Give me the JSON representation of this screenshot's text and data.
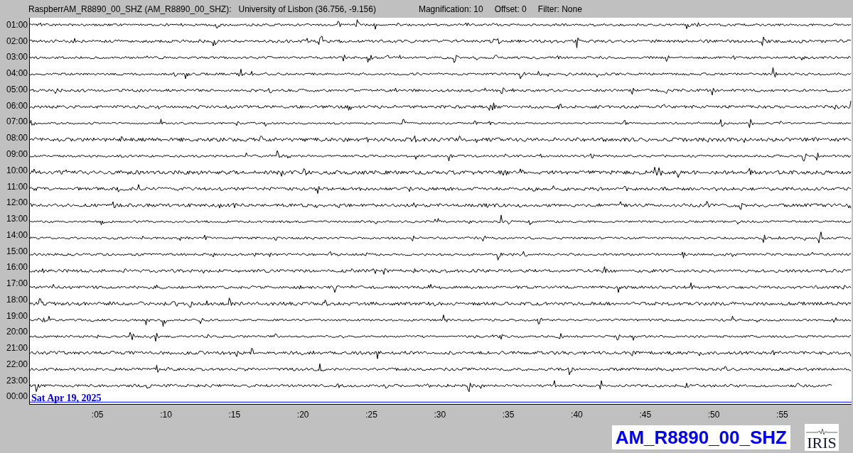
{
  "header": {
    "station": "RaspberrAM_R8890_00_SHZ (AM_R8890_00_SHZ):",
    "location": "University of Lisbon (36.756, -9.156)",
    "magnification": "Magnification: 10",
    "offset": "Offset: 0",
    "filter": "Filter: None"
  },
  "rows": [
    {
      "label": "01:00",
      "kind": "trace"
    },
    {
      "label": "02:00",
      "kind": "trace"
    },
    {
      "label": "03:00",
      "kind": "trace"
    },
    {
      "label": "04:00",
      "kind": "trace"
    },
    {
      "label": "05:00",
      "kind": "trace"
    },
    {
      "label": "06:00",
      "kind": "trace"
    },
    {
      "label": "07:00",
      "kind": "trace"
    },
    {
      "label": "08:00",
      "kind": "trace"
    },
    {
      "label": "09:00",
      "kind": "trace"
    },
    {
      "label": "10:00",
      "kind": "trace"
    },
    {
      "label": "11:00",
      "kind": "trace"
    },
    {
      "label": "12:00",
      "kind": "trace"
    },
    {
      "label": "13:00",
      "kind": "trace"
    },
    {
      "label": "14:00",
      "kind": "trace"
    },
    {
      "label": "15:00",
      "kind": "trace"
    },
    {
      "label": "16:00",
      "kind": "trace"
    },
    {
      "label": "17:00",
      "kind": "trace"
    },
    {
      "label": "18:00",
      "kind": "trace"
    },
    {
      "label": "19:00",
      "kind": "trace"
    },
    {
      "label": "20:00",
      "kind": "trace"
    },
    {
      "label": "21:00",
      "kind": "trace"
    },
    {
      "label": "22:00",
      "kind": "trace"
    },
    {
      "label": "23:00",
      "kind": "partial"
    },
    {
      "label": "00:00",
      "kind": "current"
    }
  ],
  "date": "Sat Apr 19, 2025",
  "xticks": [
    ":05",
    ":10",
    ":15",
    ":20",
    ":25",
    ":30",
    ":35",
    ":40",
    ":45",
    ":50",
    ":55"
  ],
  "channel": "AM_R8890_00_SHZ",
  "logo": "IRIS"
}
